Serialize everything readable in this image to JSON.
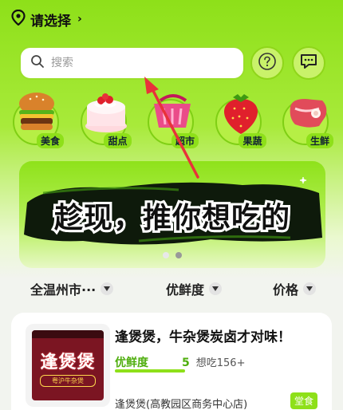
{
  "location": {
    "title": "请选择",
    "chevron": "›",
    "icon": "location-pin-icon"
  },
  "search": {
    "placeholder": "搜索",
    "icon": "search-icon"
  },
  "actions": {
    "help_icon": "help-circle-icon",
    "message_icon": "chat-bubble-icon"
  },
  "categories": [
    {
      "label": "美食",
      "icon": "burger-icon"
    },
    {
      "label": "甜点",
      "icon": "cake-icon"
    },
    {
      "label": "超市",
      "icon": "shopping-basket-icon"
    },
    {
      "label": "果蔬",
      "icon": "strawberry-icon"
    },
    {
      "label": "生鲜",
      "icon": "meat-icon"
    }
  ],
  "banner": {
    "text": "趁现，推你想吃的",
    "slide_count": 2,
    "active_slide": 2
  },
  "filters": [
    {
      "label": "全温州市···"
    },
    {
      "label": "优鲜度"
    },
    {
      "label": "价格"
    }
  ],
  "listing": {
    "title": "逢煲煲，牛杂煲炭卤才对味！",
    "freshness_label": "优鲜度",
    "freshness_score": "5",
    "freshness_level": 1.0,
    "want_text": "想吃156+",
    "address": "逢煲煲(高教园区商务中心店)",
    "tag": "堂食",
    "thumb_sign": "逢煲煲",
    "thumb_sub": "粤沪牛杂煲"
  },
  "colors": {
    "accent": "#8ee019",
    "accent_dark": "#4fae0e",
    "annotation": "#e8323a"
  }
}
